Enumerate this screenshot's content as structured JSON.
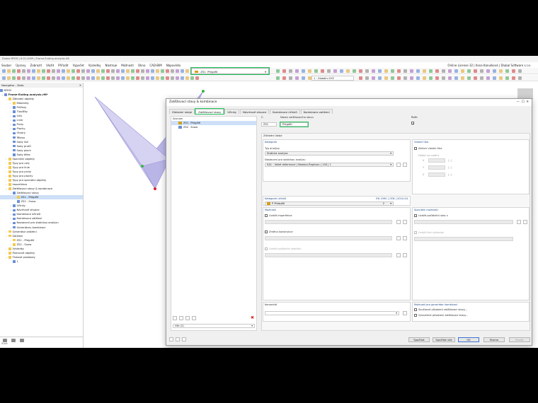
{
  "app": {
    "title": "Dlubal RFEM | 6.01.0009 | Frame-Ending analysis.rf6"
  },
  "menu": [
    "Soubor",
    "Úpravy",
    "Zobrazit",
    "Vložit",
    "Přiřadit",
    "Výpočet",
    "Výsledky",
    "Nástroje",
    "Možnosti",
    "Okno",
    "CAD-BIM",
    "Nápověda"
  ],
  "license": "Online License 32 | Ilona Kanulková | Dlubal Software s.r.o.",
  "toolbar": {
    "lc_code": "ZS1",
    "lc_name": "Přejpětí",
    "coord_system": "1 - Globální XYZ"
  },
  "navigator": {
    "title": "Navigátor - Data",
    "root": "RFEM",
    "project": "Frame-Ending analysis.rf6*",
    "items": [
      {
        "label": "Základní objekty",
        "level": 1,
        "arrow": "⌄",
        "icon": "fold"
      },
      {
        "label": "Materiály",
        "level": 2,
        "arrow": "›",
        "icon": "fold"
      },
      {
        "label": "Průřezy",
        "level": 2,
        "arrow": "›",
        "icon": "blue"
      },
      {
        "label": "Tloušťky",
        "level": 2,
        "arrow": "›",
        "icon": "blue"
      },
      {
        "label": "Uzly",
        "level": 2,
        "arrow": "›",
        "icon": "blue"
      },
      {
        "label": "Linie",
        "level": 2,
        "arrow": "›",
        "icon": "blue"
      },
      {
        "label": "Pruty",
        "level": 2,
        "arrow": "›",
        "icon": "blue"
      },
      {
        "label": "Plochy",
        "level": 2,
        "arrow": "›",
        "icon": "blue"
      },
      {
        "label": "Otvory",
        "level": 2,
        "arrow": "",
        "icon": "blue"
      },
      {
        "label": "Tělesa",
        "level": 2,
        "arrow": "",
        "icon": "blue"
      },
      {
        "label": "Sady linií",
        "level": 2,
        "arrow": "",
        "icon": "blue"
      },
      {
        "label": "Sady prutů",
        "level": 2,
        "arrow": "",
        "icon": "blue"
      },
      {
        "label": "Sady ploch",
        "level": 2,
        "arrow": "",
        "icon": "blue"
      },
      {
        "label": "Sady těles",
        "level": 2,
        "arrow": "",
        "icon": "blue"
      },
      {
        "label": "Speciální objekty",
        "level": 1,
        "arrow": "›",
        "icon": "fold"
      },
      {
        "label": "Typy pro uzly",
        "level": 1,
        "arrow": "›",
        "icon": "fold"
      },
      {
        "label": "Typy pro linie",
        "level": 1,
        "arrow": "›",
        "icon": "fold"
      },
      {
        "label": "Typy pro pruty",
        "level": 1,
        "arrow": "›",
        "icon": "fold"
      },
      {
        "label": "Typy pro plochy",
        "level": 1,
        "arrow": "›",
        "icon": "fold"
      },
      {
        "label": "Typy pro speciální objekty",
        "level": 1,
        "arrow": "›",
        "icon": "fold"
      },
      {
        "label": "Imperfekce",
        "level": 1,
        "arrow": "›",
        "icon": "fold"
      },
      {
        "label": "Zatěžovací stavy & kombinace",
        "level": 1,
        "arrow": "⌄",
        "icon": "fold"
      },
      {
        "label": "Zatěžovací stavy",
        "level": 2,
        "arrow": "⌄",
        "icon": "blue"
      },
      {
        "label": "ZS1 - Přejpětí",
        "level": 3,
        "arrow": "",
        "icon": "fold",
        "selected": true
      },
      {
        "label": "ZS2 - Snow",
        "level": 3,
        "arrow": "",
        "icon": "blue"
      },
      {
        "label": "Účinky",
        "level": 2,
        "arrow": "›",
        "icon": "blue"
      },
      {
        "label": "Návrhové situace",
        "level": 2,
        "arrow": "›",
        "icon": "blue"
      },
      {
        "label": "Kombinace účinků",
        "level": 2,
        "arrow": "›",
        "icon": "blue"
      },
      {
        "label": "Kombinace zatížení",
        "level": 2,
        "arrow": "›",
        "icon": "blue"
      },
      {
        "label": "Nastavení pro statickou analýzu",
        "level": 2,
        "arrow": "›",
        "icon": "blue"
      },
      {
        "label": "Generátory kombinací",
        "level": 2,
        "arrow": "›",
        "icon": "blue"
      },
      {
        "label": "Generátor zatížení",
        "level": 1,
        "arrow": "›",
        "icon": "fold"
      },
      {
        "label": "Zatížení",
        "level": 1,
        "arrow": "⌄",
        "icon": "fold"
      },
      {
        "label": "ZS1 - Přejpětí",
        "level": 2,
        "arrow": "›",
        "icon": "fold"
      },
      {
        "label": "ZS2 - Snow",
        "level": 2,
        "arrow": "›",
        "icon": "fold"
      },
      {
        "label": "Výsledky",
        "level": 1,
        "arrow": "›",
        "icon": "fold"
      },
      {
        "label": "Pomocné objekty",
        "level": 1,
        "arrow": "›",
        "icon": "fold"
      },
      {
        "label": "Tiskové protokoly",
        "level": 1,
        "arrow": "⌄",
        "icon": "fold"
      },
      {
        "label": "1",
        "level": 2,
        "arrow": "",
        "icon": "blue"
      }
    ]
  },
  "dialog": {
    "title": "Zatěžovací stavy & kombinace",
    "tabs": [
      "Základní údaje",
      "Zatěžovací stavy",
      "Účinky",
      "Návrhové situace",
      "Kombinace účinků",
      "Kombinace zatížení"
    ],
    "active_tab": 1,
    "list_header": "Seznam",
    "list": [
      {
        "code": "ZS1",
        "name": "Přejpětí",
        "selected": true
      },
      {
        "code": "ZS2",
        "name": "Snow",
        "selected": false
      }
    ],
    "filter": "Vše (2)",
    "no_label": "Č.",
    "no_value": "ZS1",
    "name_label": "Název zatěžovacího stavu",
    "name_value": "Přejpětí",
    "solve_label": "Řešit",
    "basic_tab": "Základní údaje",
    "category_head": "Kategorie",
    "analysis_type_label": "Typ analýzy",
    "analysis_type": "Statická analýza",
    "settings_label": "Nastavení pro statickou analýzu",
    "settings_value": "SA1 - Velké deformace | Newton-Raphson | 100 | 1",
    "action_cat_label": "Kategorie účinků",
    "action_cat_norm": "EN 1990 | CEN | 2010-04",
    "action_cat_code": "P",
    "action_cat_value": "Předpětí",
    "action_cat_num": "2",
    "selfweight_head": "Vlastní tíha",
    "selfweight_active": "Aktivní vlastní tíha",
    "selfweight_factor": "Faktor ve směru",
    "axes": [
      {
        "a": "X",
        "u": "[--]"
      },
      {
        "a": "Y",
        "u": "[--]"
      },
      {
        "a": "Z",
        "u": "[--]"
      }
    ],
    "options_head": "Možnosti",
    "opt_imperfection": "Uvážit imperfekce",
    "opt_structure": "Změna konstrukce",
    "opt_stability": "Uvážit počáteční stabilitu",
    "special_head": "Speciální možnosti",
    "sp_initial": "Uvážit počáteční stav z",
    "sp_phase": "Uvážit fázi výstavby",
    "generator_head": "Možnosti pro generátor kombinací",
    "gen_1": "Současné působení zatěžovací stavy...",
    "gen_2": "Vyloučené působení zatěžovací stavy...",
    "comment_label": "Komentář",
    "buttons": {
      "calculate": "Spočítat",
      "calculate_all": "Spočítat vše",
      "ok": "OK",
      "cancel": "Storno",
      "apply": "Použít"
    }
  },
  "status": "Start"
}
